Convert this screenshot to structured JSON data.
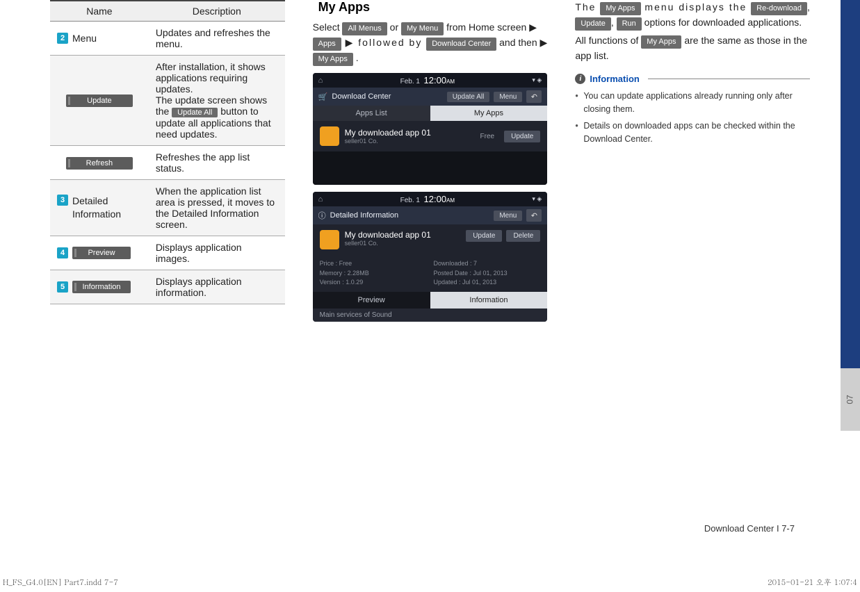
{
  "table": {
    "headers": [
      "Name",
      "Description"
    ],
    "rows": [
      {
        "num": "2",
        "name": "Menu",
        "desc": "Updates and refreshes the menu."
      },
      {
        "chip": "Update",
        "desc_pre": "After installation, it shows applications requiring updates.\nThe update screen shows the ",
        "inline_chip": "Update All",
        "desc_post": " button to update all applications that need updates."
      },
      {
        "chip": "Refresh",
        "desc": "Refreshes the app list status."
      },
      {
        "num": "3",
        "name": "Detailed Information",
        "desc": "When the application list area is pressed, it moves to the Detailed Information screen."
      },
      {
        "num": "4",
        "chip": "Preview",
        "desc": "Displays application images."
      },
      {
        "num": "5",
        "chip": "Information",
        "desc": "Displays application information."
      }
    ]
  },
  "col2": {
    "title": "My Apps",
    "line1_a": "Select ",
    "chip_all_menus": "All Menus",
    "or": " or ",
    "chip_my_menu": "My Menu",
    "line1_b": " from Home screen ▶ ",
    "chip_apps": "Apps",
    "line1_c": " ▶ followed by ",
    "chip_dl_center": "Download Center",
    "line1_d": " and then ▶ ",
    "chip_my_apps": "My Apps",
    "period": " ."
  },
  "device1": {
    "date": "Feb. 1",
    "time": "12:00",
    "ampm": "AM",
    "title": "Download Center",
    "btn_update_all": "Update All",
    "btn_menu": "Menu",
    "tab_inactive": "Apps List",
    "tab_active": "My Apps",
    "app_name": "My downloaded app 01",
    "app_seller": "seller01 Co.",
    "free": "Free",
    "btn_update": "Update"
  },
  "device2": {
    "date": "Feb. 1",
    "time": "12:00",
    "ampm": "AM",
    "title": "Detailed Information",
    "btn_menu": "Menu",
    "app_name": "My downloaded app 01",
    "app_seller": "seller01 Co.",
    "btn_update": "Update",
    "btn_delete": "Delete",
    "meta_left": "Price : Free\nMemory : 2.28MB\nVersion : 1.0.29",
    "meta_right": "Downloaded : 7\nPosted Date : Jul 01, 2013\nUpdated : Jul 01, 2013",
    "tab_dark": "Preview",
    "tab_light": "Information",
    "footer": "Main services of Sound"
  },
  "col3": {
    "line1_a": "The ",
    "chip_my_apps": "My Apps",
    "line1_b": " menu displays the ",
    "chip_redl": "Re-download",
    "comma1": ", ",
    "chip_update": "Update",
    "comma2": ", ",
    "chip_run": "Run",
    "line1_c": " options for downloaded applications.",
    "line2_a": "All functions of ",
    "chip_my_apps2": "My Apps",
    "line2_b": " are the same as those in the app list.",
    "info_label": "Information",
    "bullets": [
      "You can update applications already running only after closing them.",
      "Details on downloaded apps can be checked within the Download Center."
    ]
  },
  "side_num": "07",
  "footer": "Download Center I 7-7",
  "print_left": "H_FS_G4.0[EN] Part7.indd   7-7",
  "print_right": "2015-01-21   오후 1:07:4"
}
